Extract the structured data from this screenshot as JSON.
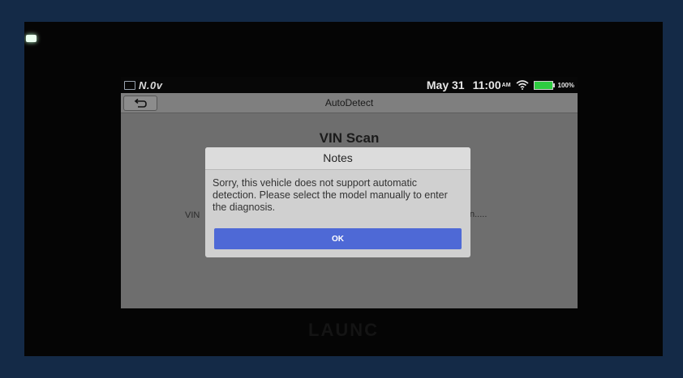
{
  "status_bar": {
    "brand": "N.0v",
    "date": "May 31",
    "time": "11:00",
    "ampm": "AM",
    "battery_percent": "100%",
    "battery_level": 1.0,
    "battery_color": "#2ecc40",
    "icons": [
      "image-icon",
      "wifi-icon",
      "battery-icon"
    ]
  },
  "header": {
    "title": "AutoDetect",
    "back_icon": "back-arrow-icon"
  },
  "main": {
    "heading": "VIN Scan",
    "vin_label": "VIN",
    "right_text": "n....."
  },
  "dialog": {
    "title": "Notes",
    "message": "Sorry, this vehicle does not support automatic detection. Please select the model manually to enter the diagnosis.",
    "ok_label": "OK",
    "ok_color": "#4e69d6"
  },
  "device": {
    "brand": "LAUNC"
  }
}
